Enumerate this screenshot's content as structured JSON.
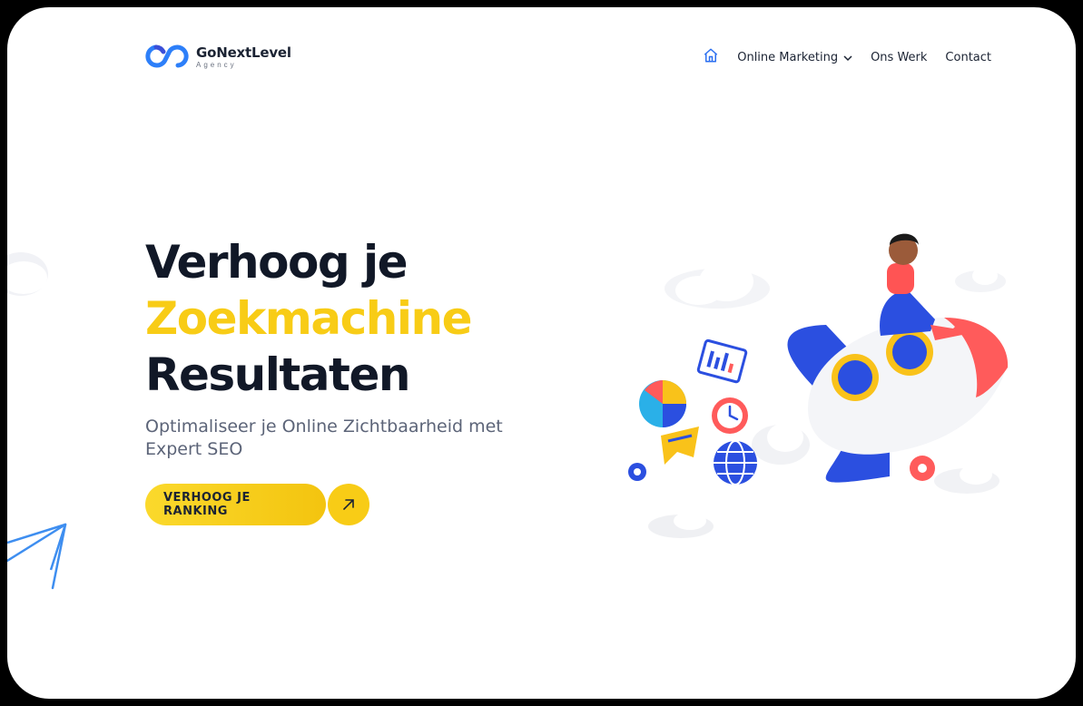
{
  "brand": {
    "name": "GoNextLevel",
    "sub": "Agency",
    "logo_colors": [
      "#2d7ff9",
      "#3a4fd8"
    ]
  },
  "nav": {
    "home_icon": "home-icon",
    "items": [
      {
        "label": "Online Marketing",
        "has_dropdown": true
      },
      {
        "label": "Ons Werk"
      },
      {
        "label": "Contact"
      }
    ]
  },
  "hero": {
    "line1": "Verhoog je",
    "line2": "Zoekmachine",
    "line3": "Resultaten",
    "subtitle": "Optimaliseer je Online Zichtbaarheid met Expert SEO",
    "cta_label": "VERHOOG JE RANKING",
    "cta_icon": "arrow-up-right-icon"
  },
  "colors": {
    "accent_yellow": "#f8cc16",
    "heading_dark": "#111827",
    "text_muted": "#5c6478",
    "accent_blue": "#2b4fe0"
  }
}
